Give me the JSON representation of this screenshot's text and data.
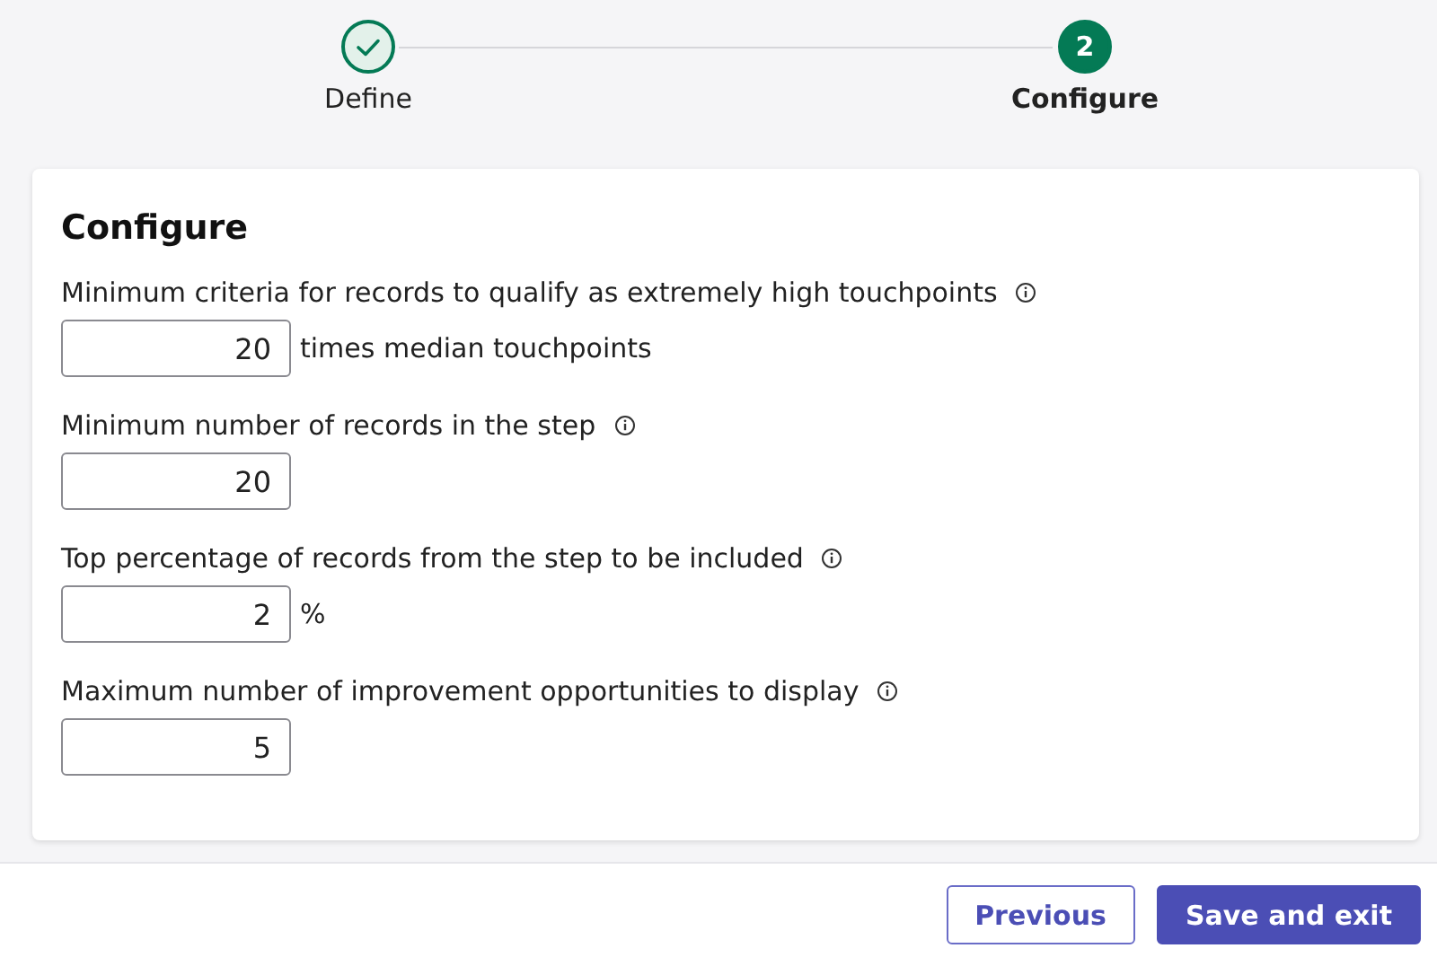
{
  "steps": [
    {
      "label": "Define",
      "kind": "done",
      "selected": false
    },
    {
      "label": "Configure",
      "kind": "current",
      "number": "2",
      "selected": true
    }
  ],
  "card": {
    "title": "Configure",
    "fields": [
      {
        "label": "Minimum criteria for records to qualify as extremely high touchpoints",
        "value": "20",
        "suffix": "times median touchpoints"
      },
      {
        "label": "Minimum number of records in the step",
        "value": "20"
      },
      {
        "label": "Top percentage of records from the step to be included",
        "value": "2",
        "suffix": "%"
      },
      {
        "label": "Maximum number of improvement opportunities to display",
        "value": "5"
      }
    ]
  },
  "footer": {
    "buttons": [
      {
        "label": "Previous",
        "kind": "secondary"
      },
      {
        "label": "Save and exit",
        "kind": "primary"
      }
    ]
  }
}
